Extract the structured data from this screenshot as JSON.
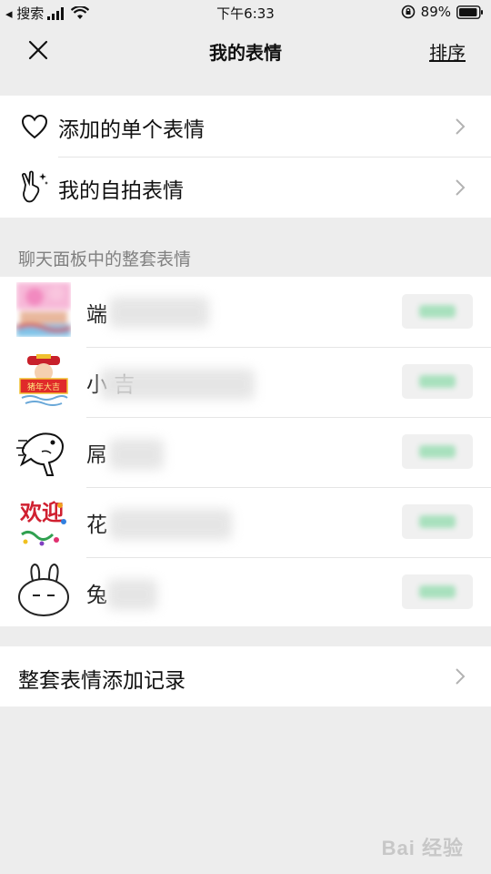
{
  "status_bar": {
    "back_label": "◂ 搜索",
    "time": "下午6:33",
    "battery": "89%"
  },
  "nav": {
    "title": "我的表情",
    "sort_label": "排序"
  },
  "menu": {
    "single_label": "添加的单个表情",
    "selfie_label": "我的自拍表情"
  },
  "section_title": "聊天面板中的整套表情",
  "packs": [
    {
      "visible_text": "端"
    },
    {
      "visible_text": "小  吉"
    },
    {
      "visible_text": "屌"
    },
    {
      "visible_text": "花"
    },
    {
      "visible_text": "兔"
    }
  ],
  "footer": {
    "history_label": "整套表情添加记录"
  },
  "thumb_text": {
    "pig_year": "猪年大吉",
    "huanying": "欢迎"
  },
  "watermark": "Bai 经验",
  "colors": {
    "background": "#ededed",
    "card": "#ffffff",
    "accent_green": "#07c160"
  }
}
